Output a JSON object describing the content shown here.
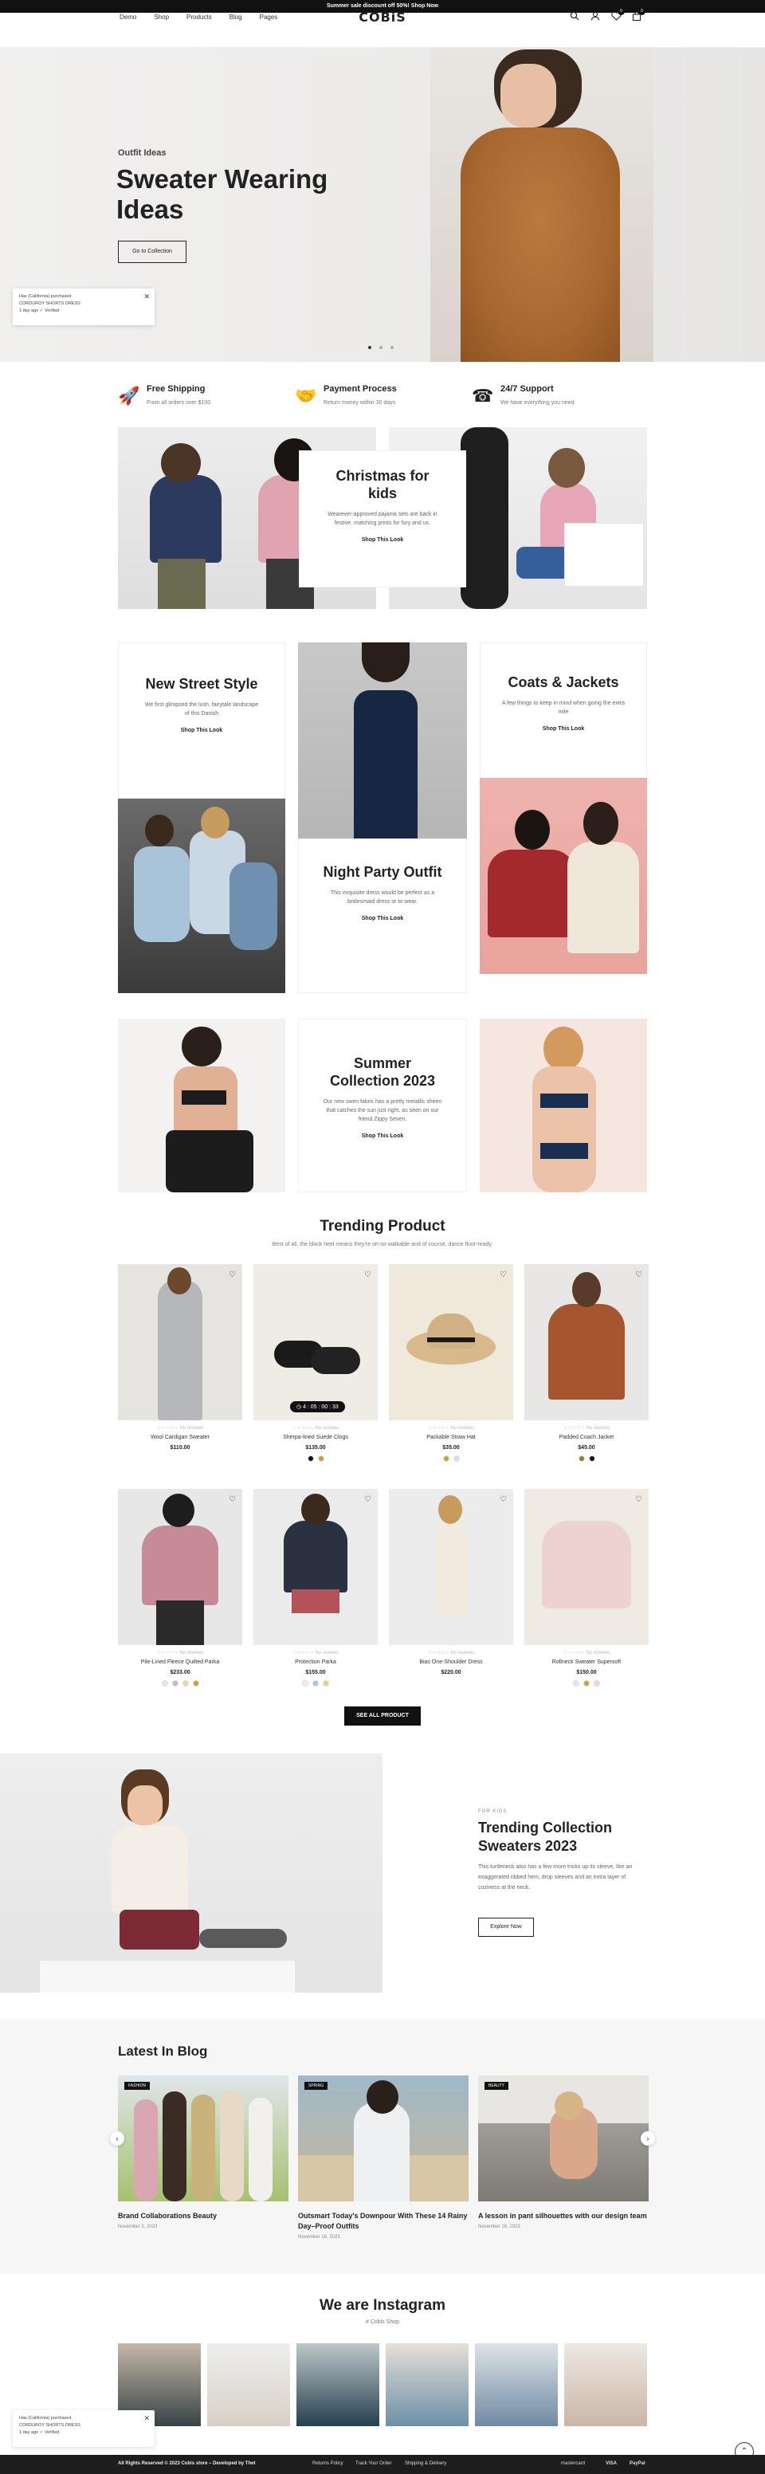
{
  "announcement": "Summer sale discount off 50%! Shop Now",
  "header": {
    "nav": [
      "Demo",
      "Shop",
      "Products",
      "Blog",
      "Pages"
    ],
    "logo": "COBiS",
    "wishlist_count": "0",
    "cart_count": "0"
  },
  "hero": {
    "subtitle": "Outfit Ideas",
    "title": "Sweater Wearing Ideas",
    "button": "Go to Collection"
  },
  "toast": {
    "line1": "Has (California) purchased",
    "product": "CORDUROY SHORTS DRESS",
    "time": "1 day ago",
    "verified": "Verified"
  },
  "features": [
    {
      "icon": "rocket-icon",
      "title": "Free Shipping",
      "text": "From all orders over $100"
    },
    {
      "icon": "handshake-icon",
      "title": "Payment Process",
      "text": "Return money within 30 days"
    },
    {
      "icon": "support-icon",
      "title": "24/7 Support",
      "text": "We have everything you need"
    }
  ],
  "kids": {
    "title": "Christmas for kids",
    "text": "Wearever-approved pajama sets are back in festive, matching prints for fury and us.",
    "link": "Shop This Look"
  },
  "lookbook": {
    "street": {
      "title": "New Street Style",
      "text": "We first glimpsed the lush, fairytale landscape of this Danish",
      "link": "Shop This Look"
    },
    "party": {
      "title": "Night Party Outfit",
      "text": "This exquisite dress would be perfect as a bridesmaid dress or to wear.",
      "link": "Shop This Look"
    },
    "coats": {
      "title": "Coats & Jackets",
      "text": "A few things to keep in mind when going the extra mile",
      "link": "Shop This Look"
    },
    "summer": {
      "title": "Summer Collection 2023",
      "text": "Our new swim fabric has a pretty metallic sheen that catches the sun just right, as seen on our friend Zippy Seven.",
      "link": "Shop This Look"
    }
  },
  "trending": {
    "title": "Trending Product",
    "subtitle": "Best of all, the block heel means they're oh-so-walkable and of course, dance floor-ready.",
    "reviews_label": "No reviews",
    "timer": "4 : 05 : 00 : 33",
    "products": [
      {
        "name": "Wool Cardigan Sweater",
        "price": "$110.00",
        "swatches": []
      },
      {
        "name": "Sherpa-lined Suede Clogs",
        "price": "$135.00",
        "swatches": [
          "#111111",
          "#c9a227"
        ]
      },
      {
        "name": "Packable Straw Hat",
        "price": "$35.00",
        "swatches": [
          "#c9a227",
          "#dddddd"
        ]
      },
      {
        "name": "Padded Coach Jacket",
        "price": "$45.00",
        "swatches": [
          "#9b7a2e",
          "#111111"
        ]
      },
      {
        "name": "Pile-Lined Fleece Quilted Parka",
        "price": "$233.00",
        "swatches": [
          "#e2e2e2",
          "#aebfd6",
          "#e8d9a6",
          "#c9a227"
        ]
      },
      {
        "name": "Protection Parka",
        "price": "$155.00",
        "swatches": [
          "#eeeeee",
          "#a9c0e0",
          "#e6d27a"
        ]
      },
      {
        "name": "Bias One-Shoulder Dress",
        "price": "$220.00",
        "swatches": []
      },
      {
        "name": "Rollneck Sweater Supersoft",
        "price": "$150.00",
        "swatches": [
          "#e6e6e6",
          "#c9a227",
          "#f0d2e6"
        ]
      }
    ],
    "all_button": "SEE ALL PRODUCT"
  },
  "collection": {
    "kicker": "FOR KIDS",
    "title": "Trending Collection Sweaters 2023",
    "text": "This turtleneck also has a few more tricks up its sleeve, like an exaggerated ribbed hem, drop sleeves and an extra layer of coziness at the neck.",
    "button": "Explore Now"
  },
  "blog": {
    "title": "Latest In Blog",
    "posts": [
      {
        "tag": "FASHION",
        "title": "Brand Collaborations Beauty",
        "date": "November 3, 2023"
      },
      {
        "tag": "SPRING",
        "title": "Outsmart Today's Downpour With These 14 Rainy Day–Proof Outfits",
        "date": "November 16, 2023"
      },
      {
        "tag": "BEAUTY",
        "title": "A lesson in pant silhouettes with our design team",
        "date": "November 16, 2023"
      }
    ]
  },
  "instagram": {
    "title": "We are Instagram",
    "handle": "# Cobis Shop"
  },
  "footer": {
    "copyright": "All Rights Reserved © 2023 Cobis store – Developed by Thet",
    "links": [
      "Returns Policy",
      "Track Your Order",
      "Shipping & Delivery"
    ],
    "payments": [
      "mastercard",
      "VISA",
      "PayPal"
    ]
  }
}
